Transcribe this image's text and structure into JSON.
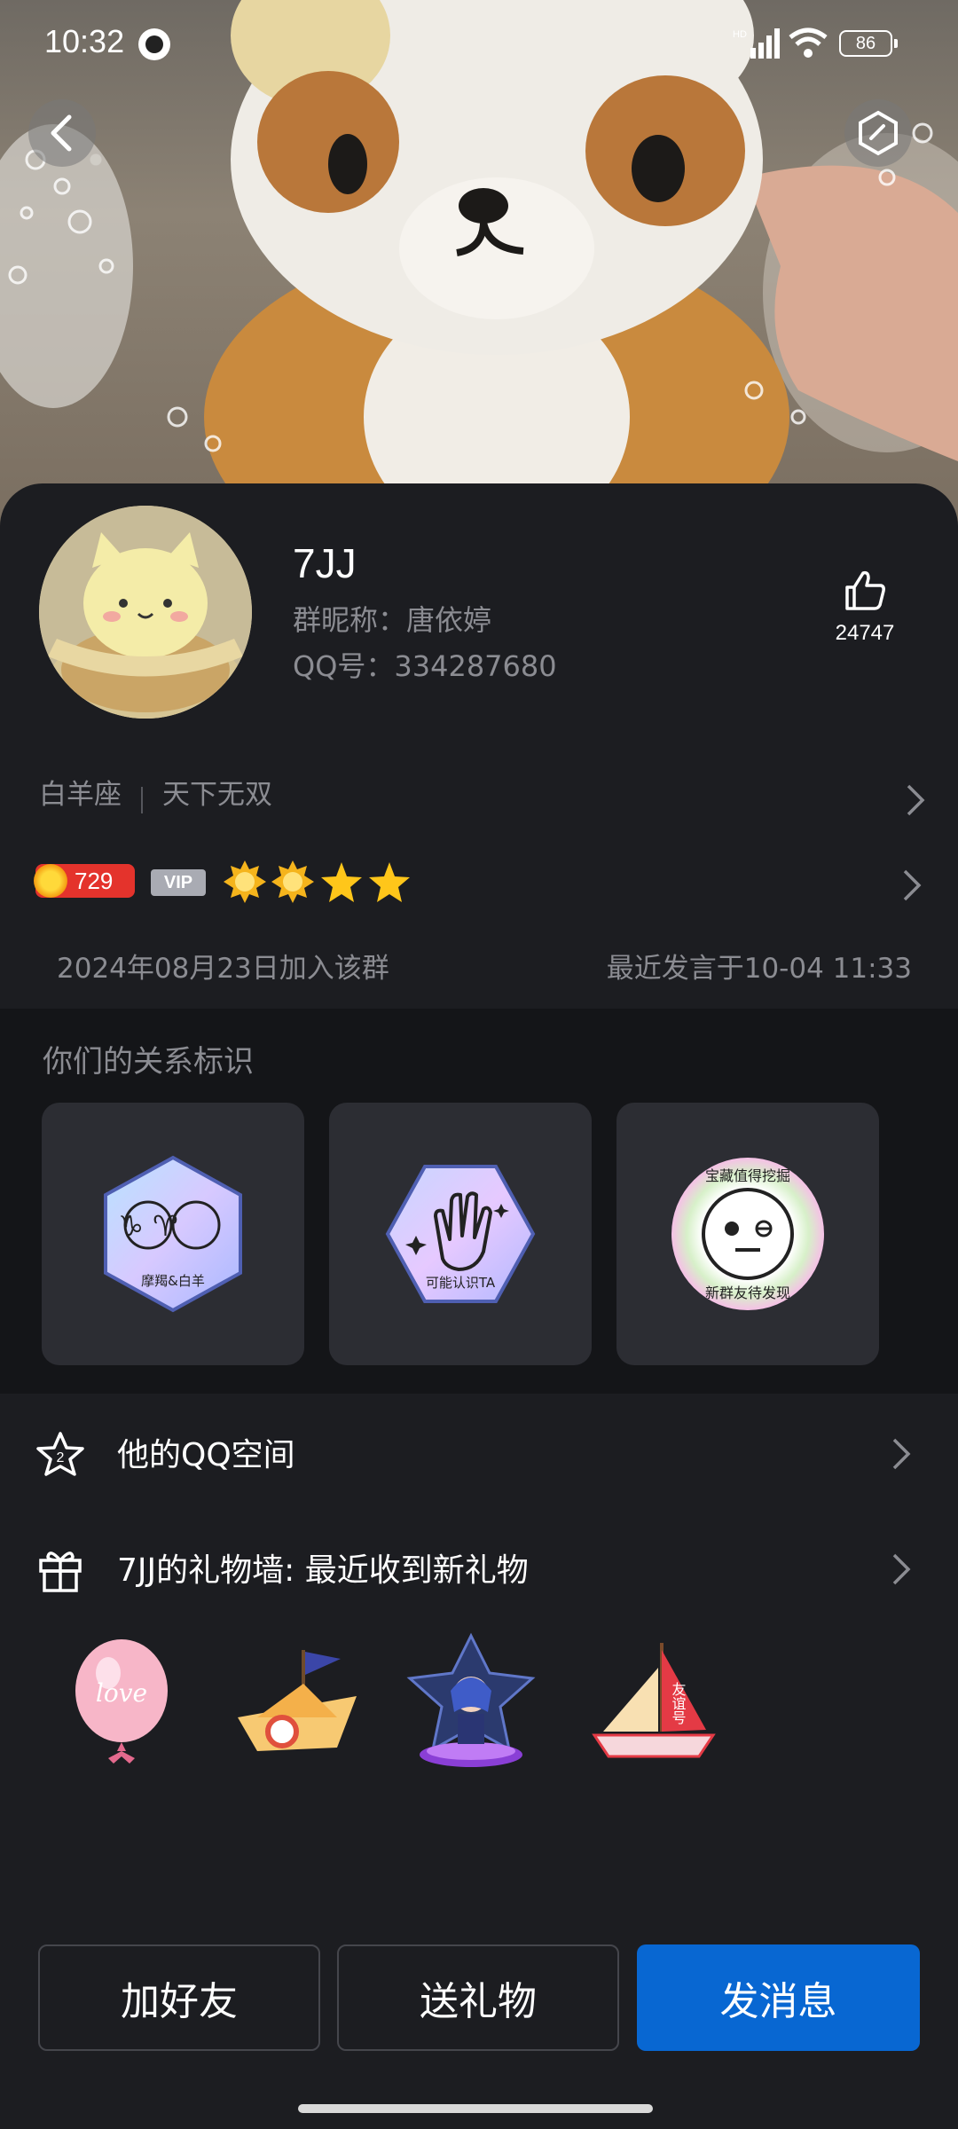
{
  "status_bar": {
    "time": "10:32",
    "battery": "86"
  },
  "profile": {
    "name": "7JJ",
    "group_nickname": "群昵称：唐依婷",
    "qq_number": "QQ号：334287680",
    "likes": "24747",
    "tags": [
      "白羊座",
      "天下无双"
    ],
    "level": "729",
    "vip_label": "VIP",
    "joined": "2024年08月23日加入该群",
    "last_spoke": "最近发言于10-04 11:33"
  },
  "relationship": {
    "title": "你们的关系标识",
    "cards": [
      {
        "label": "摩羯&白羊",
        "symbols": "♑ ♈"
      },
      {
        "label": "可能认识TA"
      },
      {
        "ring_text_top": "宝藏值得挖掘",
        "ring_text_bottom": "新群友待发现"
      }
    ]
  },
  "list": {
    "qzone": "他的QQ空间",
    "gift_wall": "7JJ的礼物墙: 最近收到新礼物",
    "qzone_badge": "2"
  },
  "gifts": [
    {
      "name": "love-balloon",
      "text": "love"
    },
    {
      "name": "paper-boat"
    },
    {
      "name": "anime-figure-stage"
    },
    {
      "name": "friendship-sailboat",
      "text": "友谊号"
    }
  ],
  "actions": {
    "add_friend": "加好友",
    "send_gift": "送礼物",
    "send_message": "发消息"
  },
  "colors": {
    "background": "#1c1d21",
    "primary": "#0867d2",
    "muted_text": "#8b8c92",
    "level_badge": "#e4332c"
  }
}
